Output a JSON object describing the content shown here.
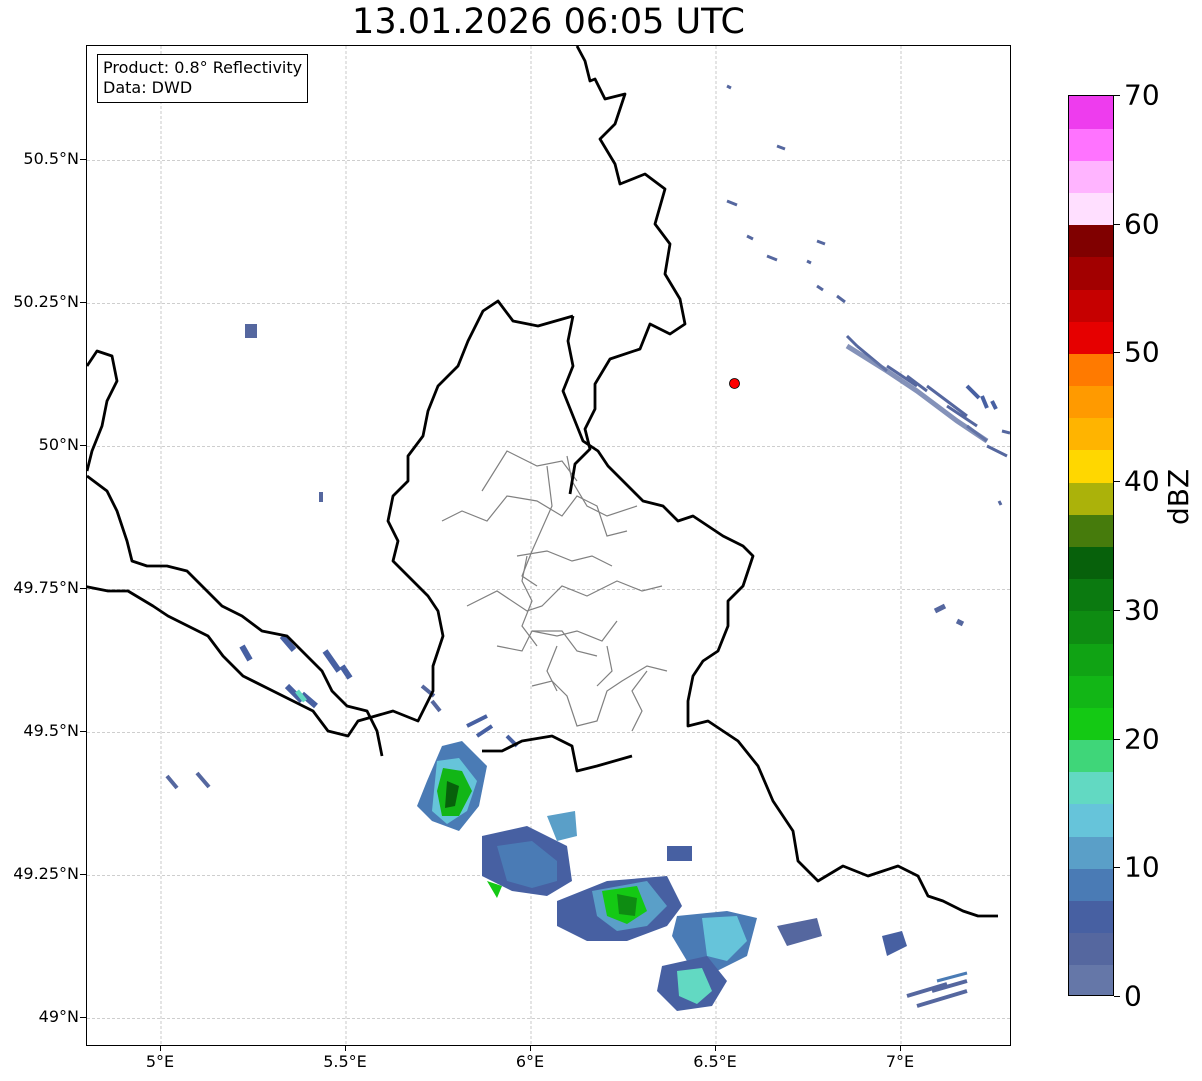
{
  "title": "13.01.2026 06:05 UTC",
  "info_box": {
    "product": "Product: 0.8° Reflectivity",
    "data": "Data: DWD"
  },
  "map": {
    "lon_range": [
      4.8,
      7.3
    ],
    "lat_range": [
      48.95,
      50.7
    ],
    "lat_ticks": [
      "50.5°N",
      "50.25°N",
      "50°N",
      "49.75°N",
      "49.5°N",
      "49.25°N",
      "49°N"
    ],
    "lat_values": [
      50.5,
      50.25,
      50.0,
      49.75,
      49.5,
      49.25,
      49.0
    ],
    "lon_ticks": [
      "5°E",
      "5.5°E",
      "6°E",
      "6.5°E",
      "7°E"
    ],
    "lon_values": [
      5.0,
      5.5,
      6.0,
      6.5,
      7.0
    ],
    "grid": true,
    "radar_site": {
      "lon": 6.55,
      "lat": 50.11,
      "color": "#ff0000"
    },
    "border_color": "#000000",
    "admin_line_color": "#808080"
  },
  "colorbar": {
    "label": "dBZ",
    "tick_labels": [
      "0",
      "10",
      "20",
      "30",
      "40",
      "50",
      "60",
      "70"
    ],
    "tick_values": [
      0,
      10,
      20,
      30,
      40,
      50,
      60,
      70
    ],
    "levels": [
      {
        "from": 0,
        "to": 2.5,
        "color": "#6577a8"
      },
      {
        "from": 2.5,
        "to": 5,
        "color": "#55679f"
      },
      {
        "from": 5,
        "to": 7.5,
        "color": "#4760a2"
      },
      {
        "from": 7.5,
        "to": 10,
        "color": "#4a7bb5"
      },
      {
        "from": 10,
        "to": 12.5,
        "color": "#5a9fc8"
      },
      {
        "from": 12.5,
        "to": 15,
        "color": "#66c4da"
      },
      {
        "from": 15,
        "to": 17.5,
        "color": "#62d9c2"
      },
      {
        "from": 17.5,
        "to": 20,
        "color": "#3fd679"
      },
      {
        "from": 20,
        "to": 22.5,
        "color": "#14c914"
      },
      {
        "from": 22.5,
        "to": 25,
        "color": "#12b616"
      },
      {
        "from": 25,
        "to": 27.5,
        "color": "#10a314"
      },
      {
        "from": 27.5,
        "to": 30,
        "color": "#0e8c12"
      },
      {
        "from": 30,
        "to": 32.5,
        "color": "#0b7a10"
      },
      {
        "from": 32.5,
        "to": 35,
        "color": "#07610b"
      },
      {
        "from": 35,
        "to": 37.5,
        "color": "#467b0c"
      },
      {
        "from": 37.5,
        "to": 40,
        "color": "#abb20a"
      },
      {
        "from": 40,
        "to": 42.5,
        "color": "#ffd700"
      },
      {
        "from": 42.5,
        "to": 45,
        "color": "#ffb400"
      },
      {
        "from": 45,
        "to": 47.5,
        "color": "#ff9a00"
      },
      {
        "from": 47.5,
        "to": 50,
        "color": "#ff7a00"
      },
      {
        "from": 50,
        "to": 52.5,
        "color": "#e60000"
      },
      {
        "from": 52.5,
        "to": 55,
        "color": "#c60000"
      },
      {
        "from": 55,
        "to": 57.5,
        "color": "#a20000"
      },
      {
        "from": 57.5,
        "to": 60,
        "color": "#800000"
      },
      {
        "from": 60,
        "to": 62.5,
        "color": "#ffdfff"
      },
      {
        "from": 62.5,
        "to": 65,
        "color": "#ffb4ff"
      },
      {
        "from": 65,
        "to": 67.5,
        "color": "#ff73ff"
      },
      {
        "from": 67.5,
        "to": 70,
        "color": "#ee3cee"
      }
    ]
  },
  "echo_areas": [
    {
      "lon": 5.25,
      "lat": 50.21,
      "dbz": 5
    },
    {
      "lon": 5.77,
      "lat": 49.4,
      "dbz": 25
    },
    {
      "lon": 5.97,
      "lat": 49.27,
      "dbz": 7
    },
    {
      "lon": 6.25,
      "lat": 49.19,
      "dbz": 20
    },
    {
      "lon": 6.52,
      "lat": 49.1,
      "dbz": 12
    },
    {
      "lon": 6.95,
      "lat": 50.2,
      "dbz": 3
    },
    {
      "lon": 5.42,
      "lat": 49.64,
      "dbz": 6
    }
  ]
}
